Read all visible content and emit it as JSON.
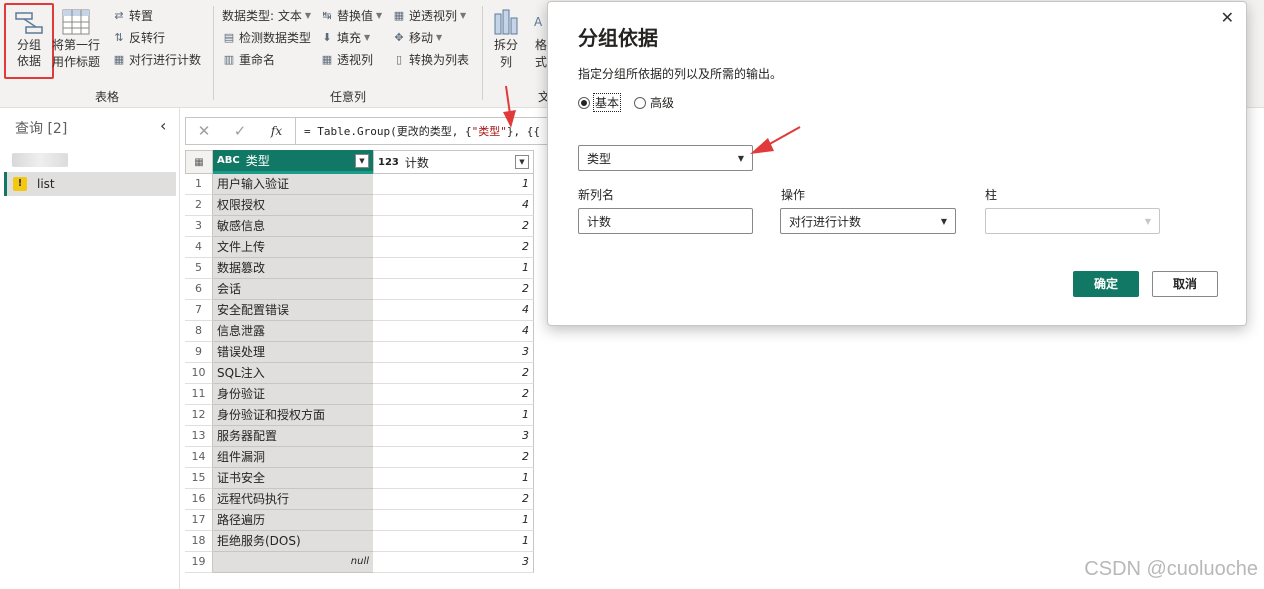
{
  "ribbon": {
    "group_by_label_line1": "分组",
    "group_by_label_line2": "依据",
    "first_row_header_line1": "将第一行",
    "first_row_header_line2": "用作标题",
    "transpose": "转置",
    "reverse_rows": "反转行",
    "count_rows": "对行进行计数",
    "table_group": "表格",
    "data_type": "数据类型: 文本",
    "detect_data_type": "检测数据类型",
    "rename": "重命名",
    "replace_values": "替换值",
    "fill": "填充",
    "pivot_column": "透视列",
    "unpivot_columns": "逆透视列",
    "move": "移动",
    "convert_to_list": "转换为列表",
    "any_column_group": "任意列",
    "split_column_line1": "拆分",
    "split_column_line2": "列",
    "format_line1": "格",
    "format_line2": "式",
    "text_group_partial": "文"
  },
  "queries_pane": {
    "title": "查询 [2]",
    "items": [
      {
        "label": "list"
      }
    ]
  },
  "formula": {
    "fx_label": "fx",
    "prefix": "= Table.Group(更改的类型, {",
    "string": "\"类型\"",
    "suffix": "}, {{"
  },
  "grid": {
    "col1_type": "ABC",
    "col1_header": "类型",
    "col2_type": "123",
    "col2_header": "计数",
    "rows": [
      {
        "n": "1",
        "type": "用户输入验证",
        "count": "1"
      },
      {
        "n": "2",
        "type": "权限授权",
        "count": "4"
      },
      {
        "n": "3",
        "type": "敏感信息",
        "count": "2"
      },
      {
        "n": "4",
        "type": "文件上传",
        "count": "2"
      },
      {
        "n": "5",
        "type": "数据篡改",
        "count": "1"
      },
      {
        "n": "6",
        "type": "会话",
        "count": "2"
      },
      {
        "n": "7",
        "type": "安全配置错误",
        "count": "4"
      },
      {
        "n": "8",
        "type": "信息泄露",
        "count": "4"
      },
      {
        "n": "9",
        "type": "错误处理",
        "count": "3"
      },
      {
        "n": "10",
        "type": "SQL注入",
        "count": "2"
      },
      {
        "n": "11",
        "type": "身份验证",
        "count": "2"
      },
      {
        "n": "12",
        "type": "身份验证和授权方面",
        "count": "1"
      },
      {
        "n": "13",
        "type": "服务器配置",
        "count": "3"
      },
      {
        "n": "14",
        "type": "组件漏洞",
        "count": "2"
      },
      {
        "n": "15",
        "type": "证书安全",
        "count": "1"
      },
      {
        "n": "16",
        "type": "远程代码执行",
        "count": "2"
      },
      {
        "n": "17",
        "type": "路径遍历",
        "count": "1"
      },
      {
        "n": "18",
        "type": "拒绝服务(DOS)",
        "count": "1"
      },
      {
        "n": "19",
        "type": "null",
        "count": "3"
      }
    ]
  },
  "dialog": {
    "title": "分组依据",
    "description": "指定分组所依据的列以及所需的输出。",
    "radio_basic": "基本",
    "radio_advanced": "高级",
    "group_column_value": "类型",
    "new_column_label": "新列名",
    "new_column_value": "计数",
    "operation_label": "操作",
    "operation_value": "对行进行计数",
    "column_label": "柱",
    "column_value": "",
    "ok": "确定",
    "cancel": "取消"
  },
  "watermark": "CSDN @cuoluoche",
  "colors": {
    "accent": "#117865",
    "highlight": "#e03a3a"
  }
}
